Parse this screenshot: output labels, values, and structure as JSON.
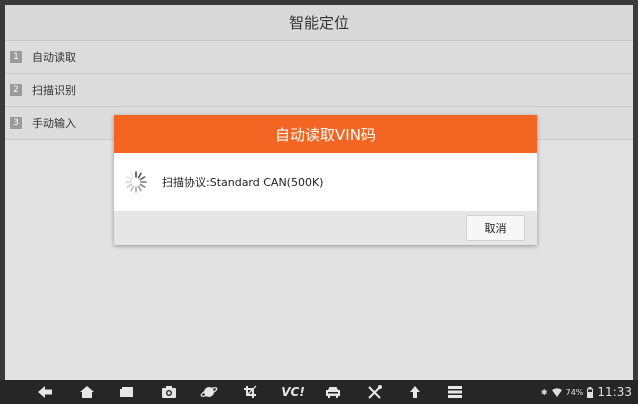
{
  "screen": {
    "title": "智能定位",
    "menu": [
      {
        "num": "1",
        "label": "自动读取"
      },
      {
        "num": "2",
        "label": "扫描识别"
      },
      {
        "num": "3",
        "label": "手动输入"
      }
    ]
  },
  "dialog": {
    "title": "自动读取VIN码",
    "message": "扫描协议:Standard CAN(500K)",
    "cancel_label": "取消"
  },
  "navbar": {
    "icons": [
      "back-icon",
      "home-icon",
      "recent-apps-icon",
      "camera-icon",
      "browser-icon",
      "crop-icon",
      "vci-icon",
      "car-icon",
      "tools-icon",
      "upload-icon",
      "menu-list-icon"
    ],
    "vci_label": "VC!",
    "battery": "74%",
    "time": "11:33"
  },
  "colors": {
    "accent": "#f26522",
    "navbar": "#262626"
  }
}
